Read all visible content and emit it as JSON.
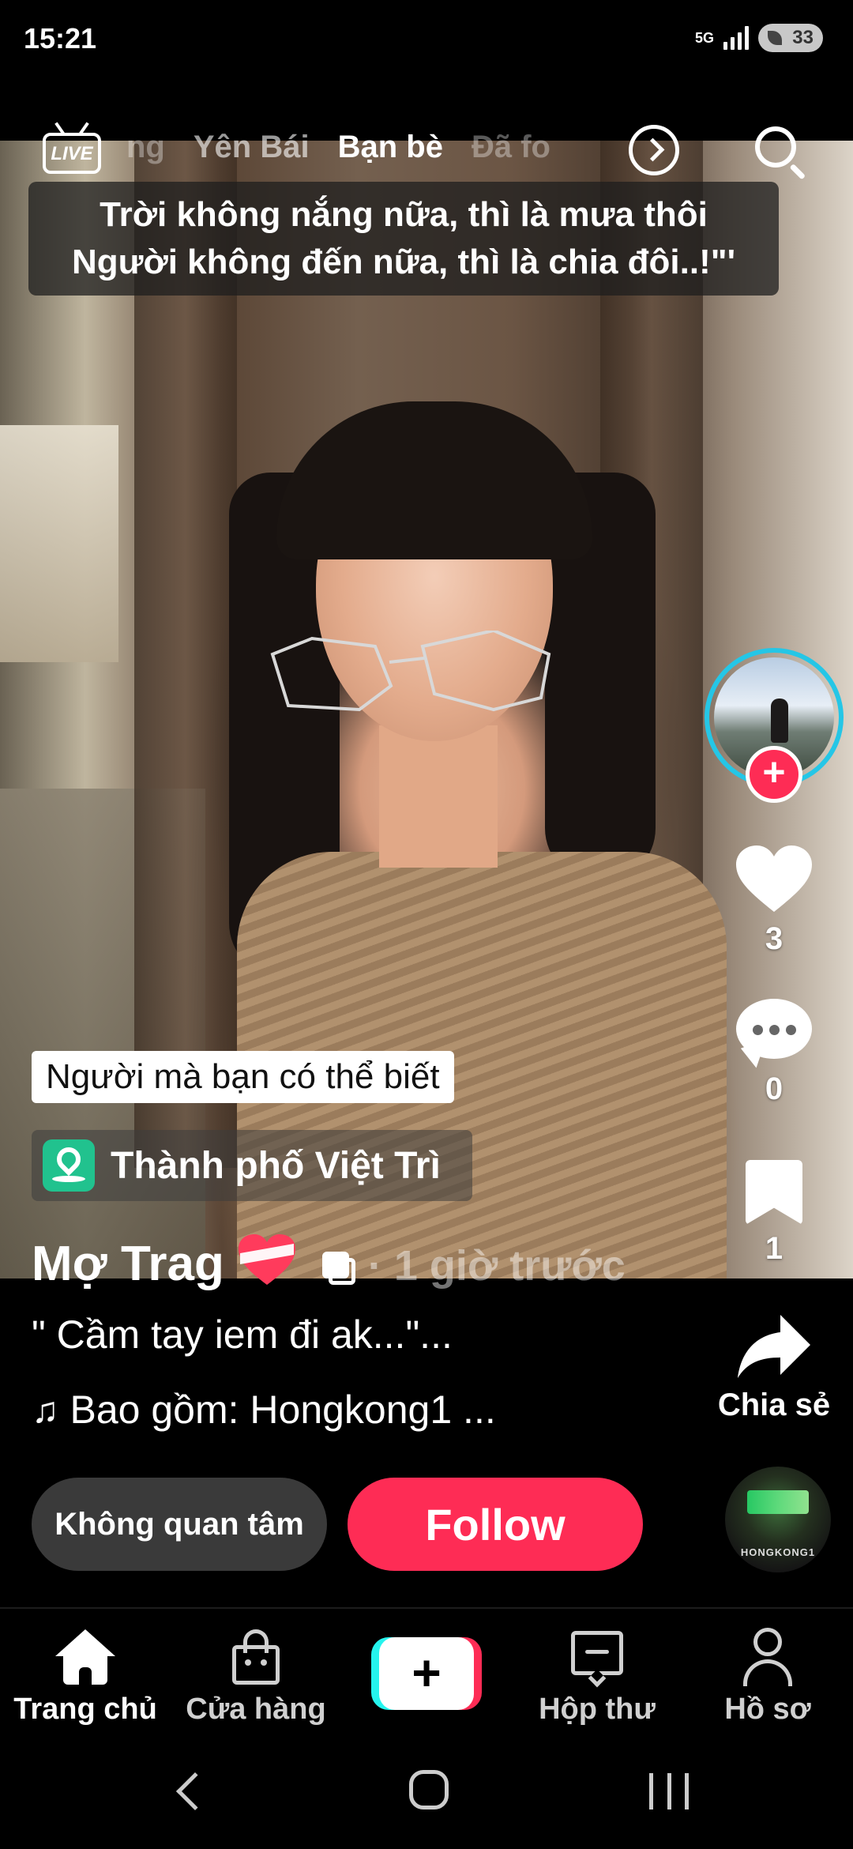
{
  "status_bar": {
    "time": "15:21",
    "network": "5G",
    "battery": "33"
  },
  "top_nav": {
    "live_label": "LIVE",
    "tabs": [
      "ng",
      "Yên Bái",
      "Bạn bè",
      "Đã fo"
    ],
    "active_tab": "Bạn bè"
  },
  "caption": {
    "line1": "Trời không nắng nữa, thì là mưa thôi",
    "line2": "Người không đến nữa, thì là chia đôi..!\"'"
  },
  "actions": {
    "like_count": "3",
    "comment_count": "0",
    "bookmark_count": "1",
    "share_label": "Chia sẻ"
  },
  "overlay": {
    "suggestion": "Người mà bạn có thể biết",
    "location": "Thành phố Việt Trì"
  },
  "post": {
    "author": "Mợ Trag",
    "time_ago": "· 1 giờ trước",
    "description": "\" Cầm tay iem đi ak...\"...",
    "music": "Bao gồm: Hongkong1 ...",
    "music_disc_text": "HONGKONG1"
  },
  "buttons": {
    "not_interested": "Không quan tâm",
    "follow": "Follow"
  },
  "bottom_nav": {
    "home": "Trang chủ",
    "shop": "Cửa hàng",
    "create": "+",
    "inbox": "Hộp thư",
    "profile": "Hồ sơ"
  },
  "colors": {
    "accent": "#fe2c55",
    "cyan": "#25f4ee",
    "avatar_ring": "#25c6e6",
    "location_icon": "#21c28e"
  },
  "icons": [
    "live-icon",
    "chevron-right-icon",
    "search-icon",
    "plus-icon",
    "heart-icon",
    "comment-icon",
    "bookmark-icon",
    "share-icon",
    "location-icon",
    "heart-emoji-icon",
    "multi-image-icon",
    "music-note-icon",
    "home-icon",
    "shop-icon",
    "inbox-icon",
    "profile-icon"
  ]
}
